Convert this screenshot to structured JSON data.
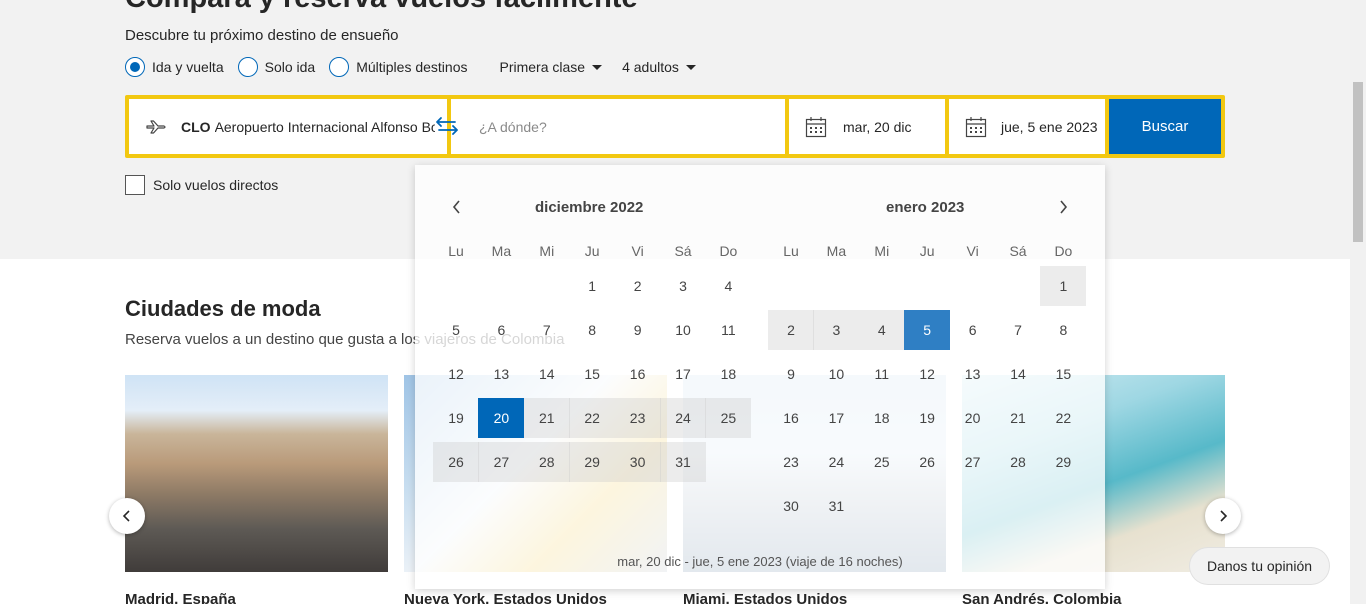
{
  "hero": {
    "title": "Compara y reserva vuelos fácilmente",
    "subtitle": "Descubre tu próximo destino de ensueño"
  },
  "trip_type": {
    "options": [
      "Ida y vuelta",
      "Solo ida",
      "Múltiples destinos"
    ],
    "selected": "Ida y vuelta"
  },
  "dropdowns": {
    "cabin": "Primera clase",
    "passengers": "4 adultos"
  },
  "search": {
    "origin_code": "CLO",
    "origin_name": "Aeropuerto Internacional Alfonso Bonilla Aragón",
    "destination_placeholder": "¿A dónde?",
    "departure": "mar, 20 dic",
    "return": "jue, 5 ene 2023",
    "button": "Buscar"
  },
  "direct_only": {
    "label": "Solo vuelos directos",
    "checked": false
  },
  "trending": {
    "title": "Ciudades de moda",
    "subtitle": "Reserva vuelos a un destino que gusta a los viajeros de Colombia",
    "cards": [
      {
        "caption": "Madrid, España"
      },
      {
        "caption": "Nueva York, Estados Unidos"
      },
      {
        "caption": "Miami, Estados Unidos"
      },
      {
        "caption": "San Andrés, Colombia"
      }
    ]
  },
  "calendar": {
    "weekdays": [
      "Lu",
      "Ma",
      "Mi",
      "Ju",
      "Vi",
      "Sá",
      "Do"
    ],
    "months": [
      {
        "title": "diciembre 2022",
        "first_weekday": 3,
        "days": 31
      },
      {
        "title": "enero 2023",
        "first_weekday": 6,
        "days": 31
      }
    ],
    "range_start": {
      "month": 0,
      "day": 20
    },
    "range_end": {
      "month": 1,
      "day": 5
    },
    "summary": "mar, 20 dic - jue, 5 ene 2023 (viaje de 16 noches)"
  },
  "feedback": {
    "label": "Danos tu opinión"
  },
  "icons": {
    "plane": "plane-icon",
    "swap": "swap-icon",
    "calendar": "calendar-icon",
    "prev": "chevron-left-icon",
    "next": "chevron-right-icon"
  },
  "colors": {
    "accent": "#0067b8",
    "highlight_border": "#f2c811"
  }
}
